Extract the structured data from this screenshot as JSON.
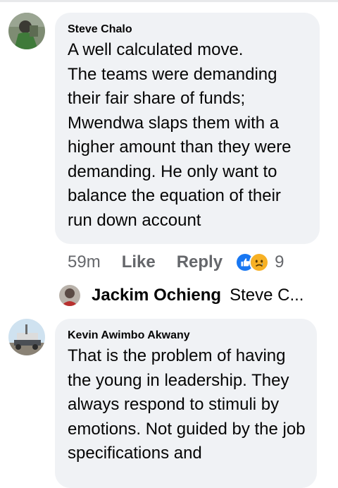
{
  "comments": [
    {
      "author": "Steve Chalo",
      "text": "A well calculated move.\nThe teams were demanding their fair share of funds; Mwendwa slaps them with a higher amount than they were demanding. He only want to balance the equation of their run down account",
      "time": "59m",
      "like_label": "Like",
      "reply_label": "Reply",
      "reaction_count": "9",
      "reactions": [
        "like-icon",
        "sad-icon"
      ]
    },
    {
      "author": "Kevin Awimbo Akwany",
      "text": "That is the problem of having the young in leadership. They always respond to stimuli by emotions. Not guided by the job specifications and"
    }
  ],
  "reply_preview": {
    "author": "Jackim Ochieng",
    "snippet": "Steve C..."
  },
  "colors": {
    "bubble": "#f0f2f5",
    "meta": "#65676b",
    "like_blue": "#1877f2",
    "sad_yellow": "#f7b125"
  }
}
